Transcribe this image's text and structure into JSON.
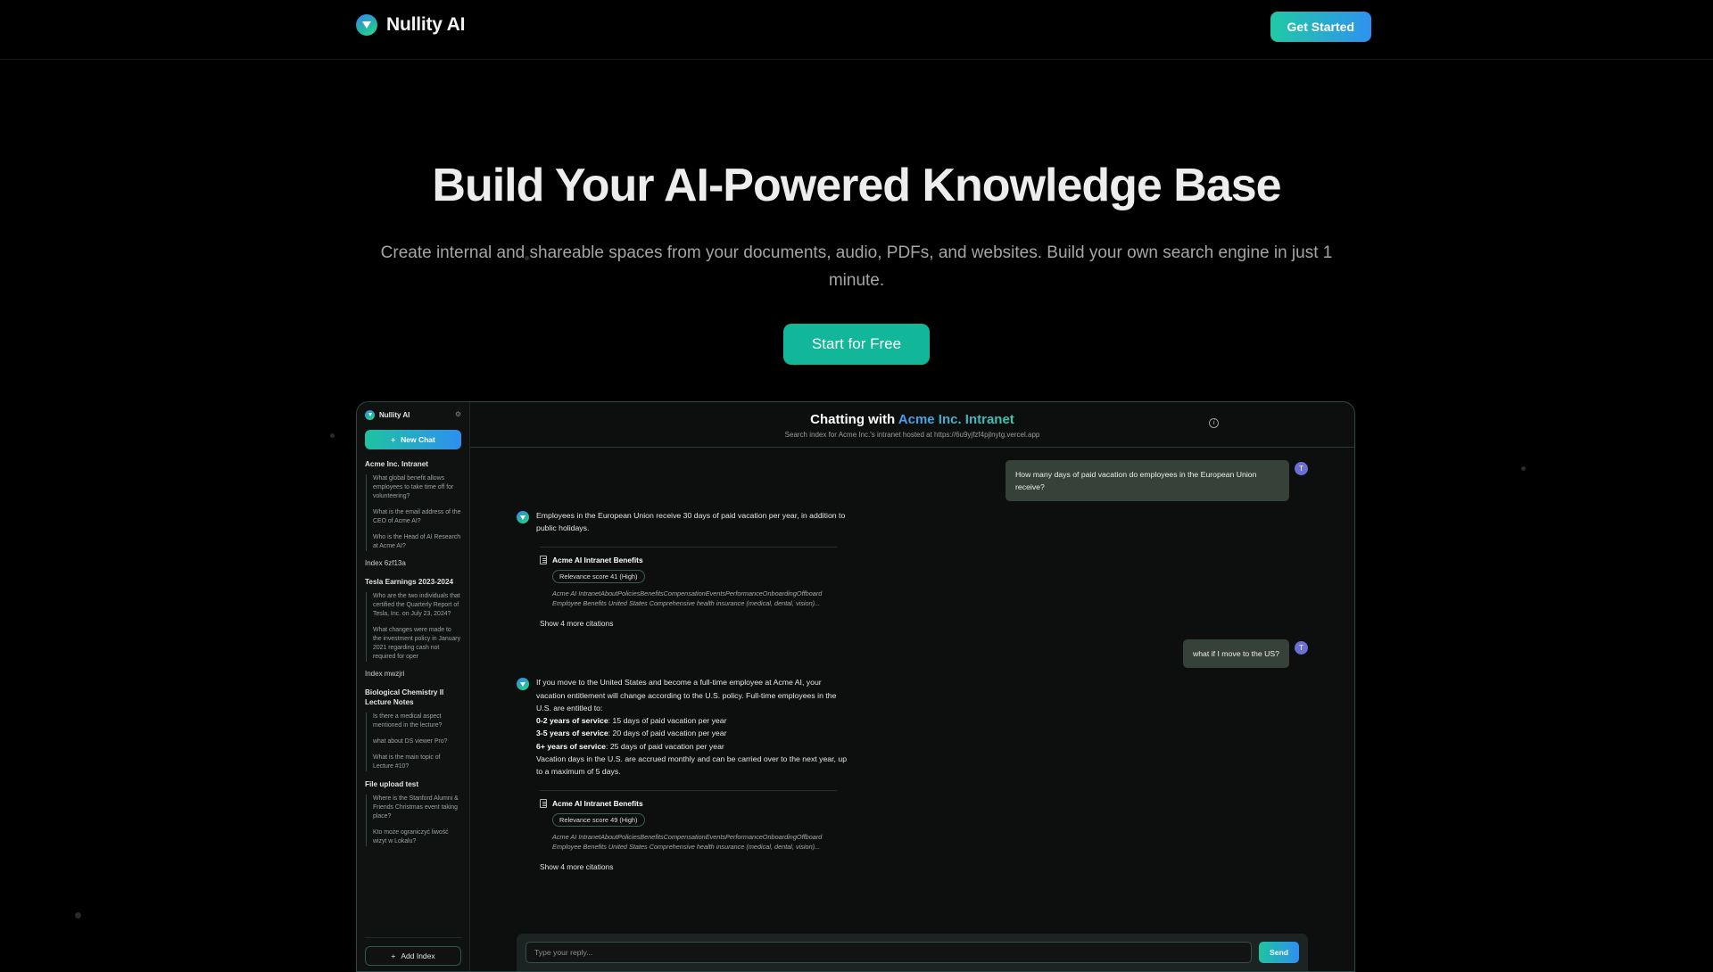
{
  "navbar": {
    "brand": "Nullity AI",
    "logo_icon": "triangle-logo-icon",
    "cta_label": "Get Started"
  },
  "hero": {
    "heading": "Build Your AI-Powered Knowledge Base",
    "subheading": "Create internal and shareable spaces from your documents, audio, PDFs, and websites. Build your own search engine in just 1 minute.",
    "cta_label": "Start for Free"
  },
  "app": {
    "sidebar": {
      "brand": "Nullity AI",
      "settings_icon": "gear-icon",
      "new_chat_label": "New Chat",
      "new_chat_icon": "plus-icon",
      "add_index_label": "Add Index",
      "add_index_icon": "plus-icon",
      "groups": [
        {
          "title": "Acme Inc. Intranet",
          "threads": [
            "What global benefit allows employees to take time off for volunteering?",
            "What is the email address of the CEO of Acme AI?",
            "Who is the Head of AI Research at Acme AI?"
          ],
          "index": "Index 6zf13a"
        },
        {
          "title": "Tesla Earnings 2023-2024",
          "threads": [
            "Who are the two individuals that certified the Quarterly Report of Tesla, Inc. on July 23, 2024?",
            "What changes were made to the investment policy in January 2021 regarding cash not required for oper"
          ],
          "index": "Index mwzjri"
        },
        {
          "title": "Biological Chemistry II Lecture Notes",
          "threads": [
            "Is there a medical aspect mentioned in the lecture?",
            "what about DS viewer Pro?",
            "What is the main topic of Lecture #10?"
          ],
          "index": ""
        },
        {
          "title": "File upload test",
          "threads": [
            "Where is the Stanford Alumni & Friends Christmas event taking place?",
            "Kto może ograniczyć liwość wizyt w Lokalu?"
          ],
          "index": ""
        }
      ]
    },
    "header": {
      "title_prefix": "Chatting with ",
      "title_accent": "Acme Inc. Intranet",
      "subtitle": "Search index for Acme Inc.'s intranet hosted at https://6u9yjfzf4pjlnytg.vercel.app",
      "info_icon": "info-icon",
      "info_glyph": "i"
    },
    "messages": [
      {
        "role": "user",
        "avatar": "T",
        "text": "How many days of paid vacation do employees in the European Union receive?"
      },
      {
        "role": "bot",
        "text": "Employees in the European Union receive 30 days of paid vacation per year, in addition to public holidays.",
        "citation": {
          "doc_icon": "document-icon",
          "title": "Acme AI Intranet Benefits",
          "score_label": "Relevance score 41 (High)",
          "snippet": "Acme AI IntranetAboutPoliciesBenefitsCompensationEventsPerformanceOnboardingOffboard Employee Benefits United States Comprehensive health insurance (medical, dental, vision)...",
          "show_more": "Show 4 more citations"
        }
      },
      {
        "role": "user",
        "avatar": "T",
        "text": "what if I move to the US?"
      },
      {
        "role": "bot",
        "text": "If you move to the United States and become a full-time employee at Acme AI, your vacation entitlement will change according to the U.S. policy. Full-time employees in the U.S. are entitled to:",
        "bullets": [
          {
            "label": "0-2 years of service",
            "value": ": 15 days of paid vacation per year"
          },
          {
            "label": "3-5 years of service",
            "value": ": 20 days of paid vacation per year"
          },
          {
            "label": "6+ years of service",
            "value": ": 25 days of paid vacation per year"
          }
        ],
        "closing": "Vacation days in the U.S. are accrued monthly and can be carried over to the next year, up to a maximum of 5 days.",
        "citation": {
          "doc_icon": "document-icon",
          "title": "Acme AI Intranet Benefits",
          "score_label": "Relevance score 49 (High)",
          "snippet": "Acme AI IntranetAboutPoliciesBenefitsCompensationEventsPerformanceOnboardingOffboard Employee Benefits United States Comprehensive health insurance (medical, dental, vision)...",
          "show_more": "Show 4 more citations"
        }
      }
    ],
    "composer": {
      "placeholder": "Type your reply...",
      "value": "",
      "send_label": "Send"
    }
  },
  "colors": {
    "accent_teal": "#12b699",
    "accent_blue": "#2f92f0",
    "background": "#000000",
    "panel": "#0d0f0f"
  }
}
